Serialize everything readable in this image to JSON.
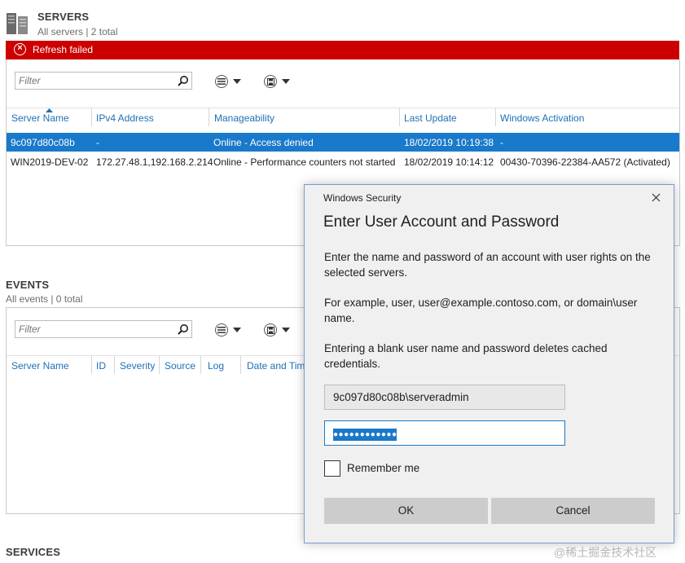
{
  "servers": {
    "title": "SERVERS",
    "subtitle": "All servers | 2 total",
    "error_banner": "Refresh failed",
    "filter_placeholder": "Filter",
    "columns": [
      "Server Name",
      "IPv4 Address",
      "Manageability",
      "Last Update",
      "Windows Activation"
    ],
    "rows": [
      {
        "name": "9c097d80c08b",
        "ipv4": "-",
        "manageability": "Online - Access denied",
        "last_update": "18/02/2019 10:19:38",
        "activation": "-"
      },
      {
        "name": "WIN2019-DEV-02",
        "ipv4": "172.27.48.1,192.168.2.214",
        "manageability": "Online - Performance counters not started",
        "last_update": "18/02/2019 10:14:12",
        "activation": "00430-70396-22384-AA572 (Activated)"
      }
    ]
  },
  "events": {
    "title": "EVENTS",
    "subtitle": "All events | 0 total",
    "filter_placeholder": "Filter",
    "columns": [
      "Server Name",
      "ID",
      "Severity",
      "Source",
      "Log",
      "Date and Tim"
    ]
  },
  "services": {
    "title": "SERVICES"
  },
  "dialog": {
    "window_title": "Windows Security",
    "heading": "Enter User Account and Password",
    "para1": "Enter the name and password of an account with user rights on the selected servers.",
    "para2": "For example, user, user@example.contoso.com, or domain\\user name.",
    "para3": "Entering a blank user name and password deletes cached credentials.",
    "username_value": "9c097d80c08b\\serveradmin",
    "password_mask": "●●●●●●●●●●●●",
    "remember_label": "Remember me",
    "ok_label": "OK",
    "cancel_label": "Cancel"
  },
  "watermark": "@稀土掘金技术社区",
  "colors": {
    "error_red": "#cc0000",
    "selection_blue": "#1979ca",
    "header_blue": "#1f6fb5",
    "dialog_border": "#7a9ccf"
  }
}
